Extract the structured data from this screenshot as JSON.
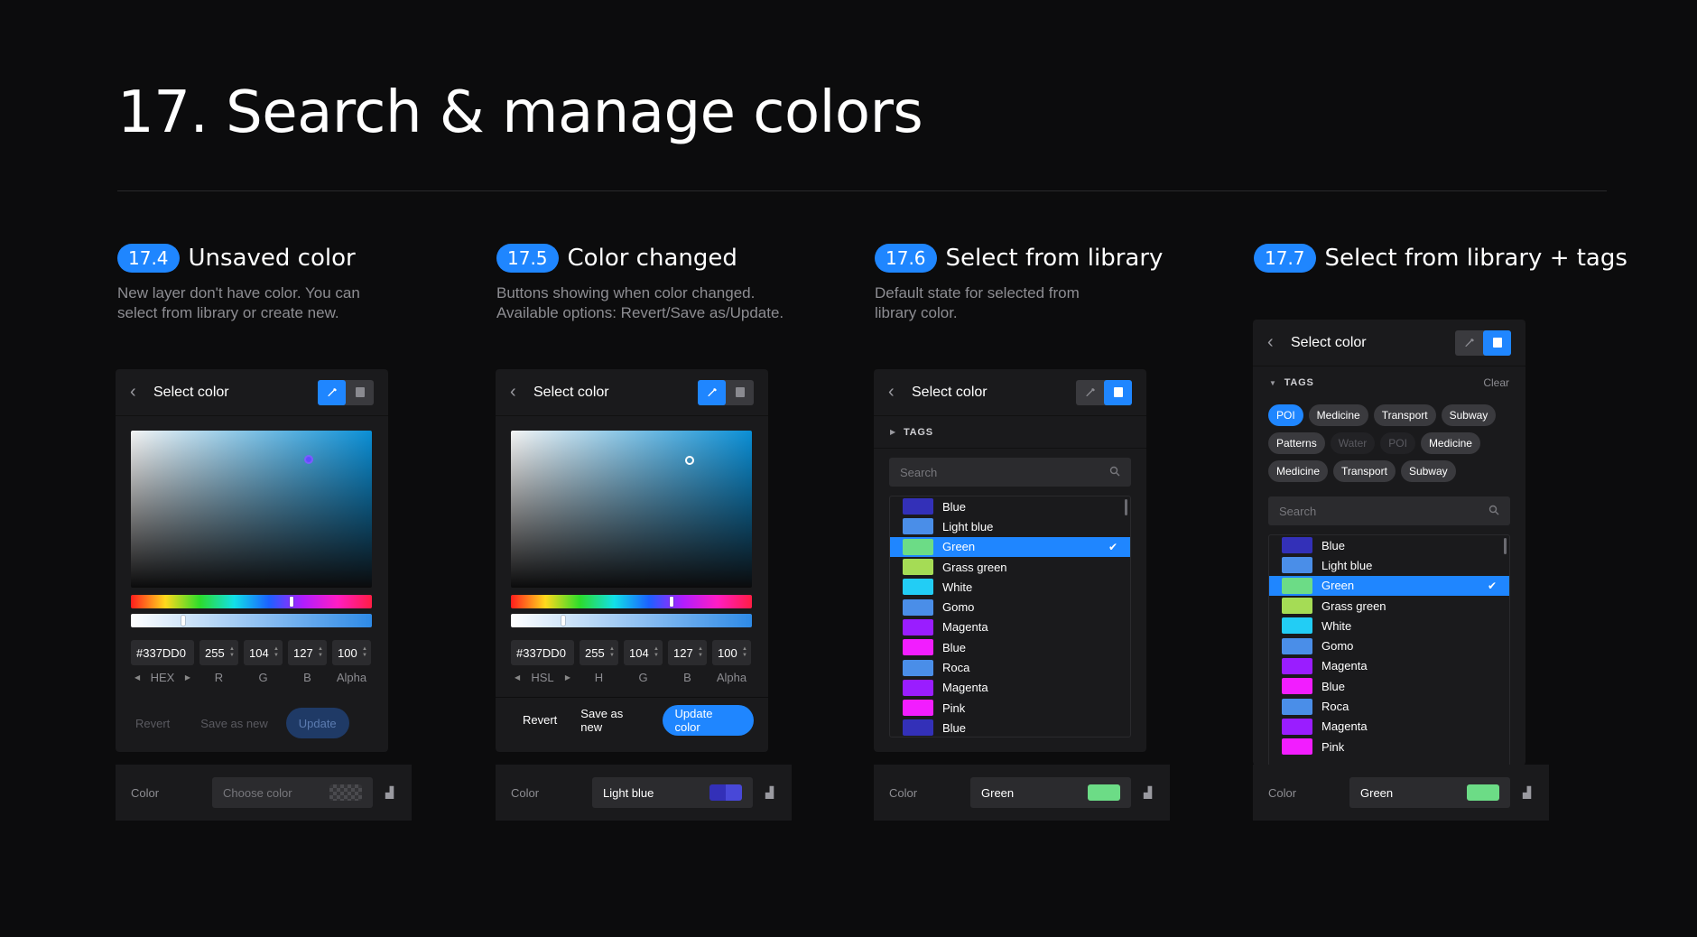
{
  "page": {
    "title": "17. Search & manage colors"
  },
  "sections": [
    {
      "badge": "17.4",
      "title": "Unsaved color",
      "desc": "New layer don't have color. You can\nselect from library or create new."
    },
    {
      "badge": "17.5",
      "title": "Color changed",
      "desc": "Buttons showing when color changed.\nAvailable options: Revert/Save as/Update."
    },
    {
      "badge": "17.6",
      "title": "Select from library",
      "desc": "Default state for selected from\nlibrary color."
    },
    {
      "badge": "17.7",
      "title": "Select from library + tags",
      "desc": ""
    }
  ],
  "panel_title": "Select color",
  "panel1": {
    "hex": "#337DD0",
    "v1": "255",
    "v2": "104",
    "v3": "127",
    "alpha": "100",
    "mode": "HEX",
    "l1": "R",
    "l2": "G",
    "l3": "B",
    "l_alpha": "Alpha",
    "revert": "Revert",
    "save_as": "Save as new",
    "update": "Update"
  },
  "panel2": {
    "hex": "#337DD0",
    "v1": "255",
    "v2": "104",
    "v3": "127",
    "alpha": "100",
    "mode": "HSL",
    "l1": "H",
    "l2": "G",
    "l3": "B",
    "l_alpha": "Alpha",
    "revert": "Revert",
    "save_as": "Save as new",
    "update": "Update color"
  },
  "tags_label": "TAGS",
  "clear_label": "Clear",
  "search_placeholder": "Search",
  "tags": [
    {
      "label": "POI",
      "state": "active"
    },
    {
      "label": "Medicine",
      "state": "normal"
    },
    {
      "label": "Transport",
      "state": "normal"
    },
    {
      "label": "Subway",
      "state": "normal"
    },
    {
      "label": "Patterns",
      "state": "normal"
    },
    {
      "label": "Water",
      "state": "disabled"
    },
    {
      "label": "POI",
      "state": "disabled"
    },
    {
      "label": "Medicine",
      "state": "normal"
    },
    {
      "label": "Medicine",
      "state": "normal"
    },
    {
      "label": "Transport",
      "state": "normal"
    },
    {
      "label": "Subway",
      "state": "normal"
    }
  ],
  "library": [
    {
      "name": "Blue",
      "color": "#3330b8"
    },
    {
      "name": "Light blue",
      "color": "#4a8ee8"
    },
    {
      "name": "Green",
      "color": "#6cdc86"
    },
    {
      "name": "Grass green",
      "color": "#a5dc55"
    },
    {
      "name": "White",
      "color": "#22cdf5"
    },
    {
      "name": "Gomo",
      "color": "#4a8ee8"
    },
    {
      "name": "Magenta",
      "color": "#9a1dff"
    },
    {
      "name": "Blue",
      "color": "#f21dff"
    },
    {
      "name": "Roca",
      "color": "#4a8ee8"
    },
    {
      "name": "Magenta",
      "color": "#9a1dff"
    },
    {
      "name": "Pink",
      "color": "#f21dff"
    },
    {
      "name": "Blue",
      "color": "#3330b8"
    }
  ],
  "color_rows": [
    {
      "label": "Color",
      "value": "Choose color",
      "swatch": "checker"
    },
    {
      "label": "Color",
      "value": "Light blue",
      "swatch": "#3a3ac8"
    },
    {
      "label": "Color",
      "value": "Green",
      "swatch": "#6cdc86"
    },
    {
      "label": "Color",
      "value": "Green",
      "swatch": "#6cdc86"
    }
  ],
  "colors": {
    "accent": "#1f86ff",
    "background": "#0c0c0d",
    "panel": "#1a1a1c"
  },
  "icons": {
    "back": "chevron-left-icon",
    "picker": "eyedropper-icon",
    "library": "book-icon",
    "search": "search-icon",
    "check": "check-icon",
    "levels": "levels-icon"
  }
}
